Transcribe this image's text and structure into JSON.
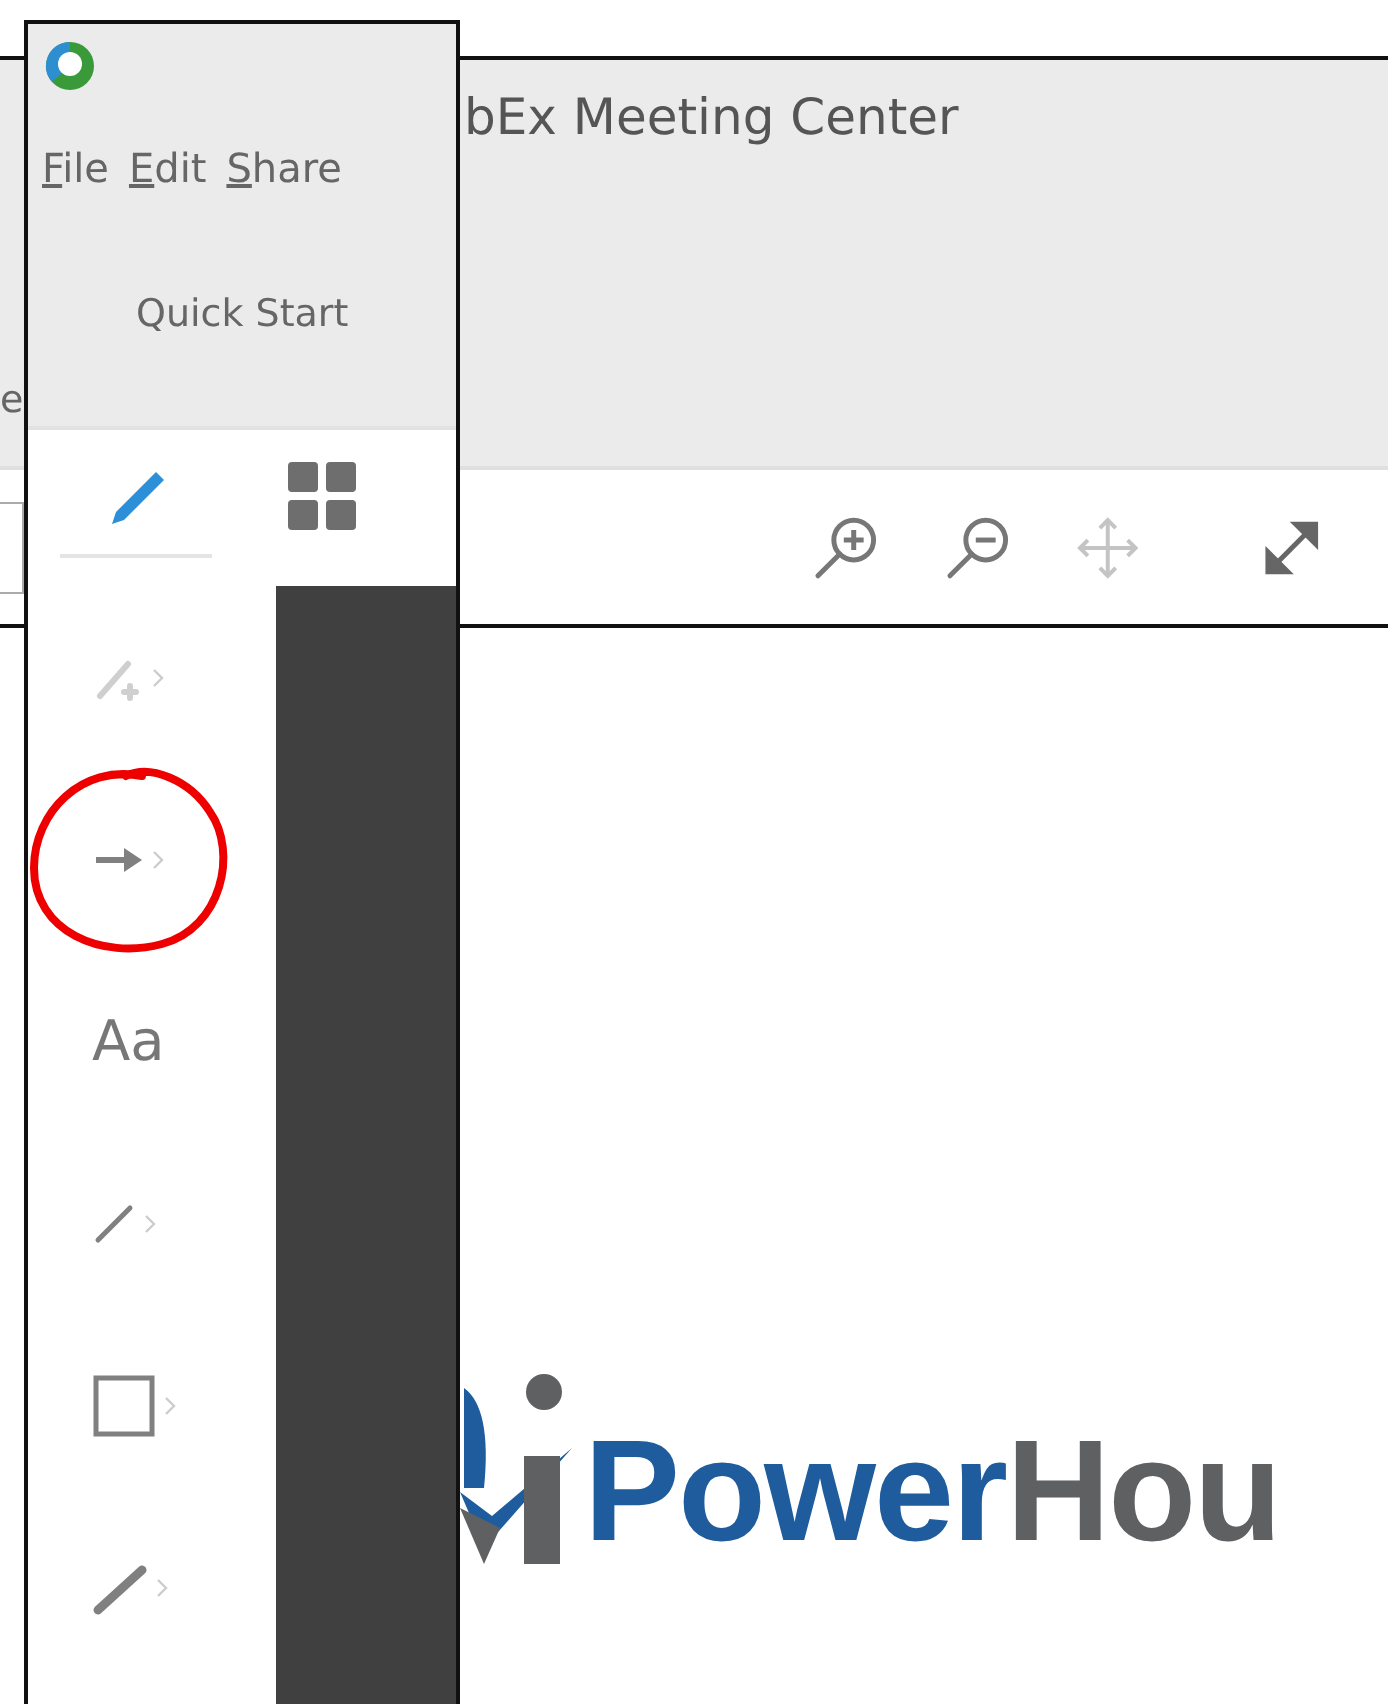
{
  "window": {
    "title": "bEx Meeting Center",
    "ribbon_label": "e"
  },
  "panel": {
    "menu": [
      {
        "label": "File"
      },
      {
        "label": "Edit"
      },
      {
        "label": "Share"
      }
    ],
    "section": "Quick Start",
    "tabs": [
      {
        "kind": "draw",
        "selected": true
      },
      {
        "kind": "grid",
        "selected": false
      }
    ],
    "tools": [
      {
        "kind": "highlighter",
        "disabled": true,
        "has_submenu": true,
        "circled": false
      },
      {
        "kind": "arrow",
        "disabled": false,
        "has_submenu": true,
        "circled": true
      },
      {
        "kind": "text",
        "label": "Aa",
        "disabled": false,
        "has_submenu": false,
        "circled": false
      },
      {
        "kind": "line",
        "disabled": false,
        "has_submenu": true,
        "circled": false
      },
      {
        "kind": "rectangle",
        "disabled": false,
        "has_submenu": true,
        "circled": false
      },
      {
        "kind": "pen",
        "disabled": false,
        "has_submenu": true,
        "circled": false
      }
    ]
  },
  "logo": {
    "primary": "Power",
    "secondary": "Hou"
  }
}
